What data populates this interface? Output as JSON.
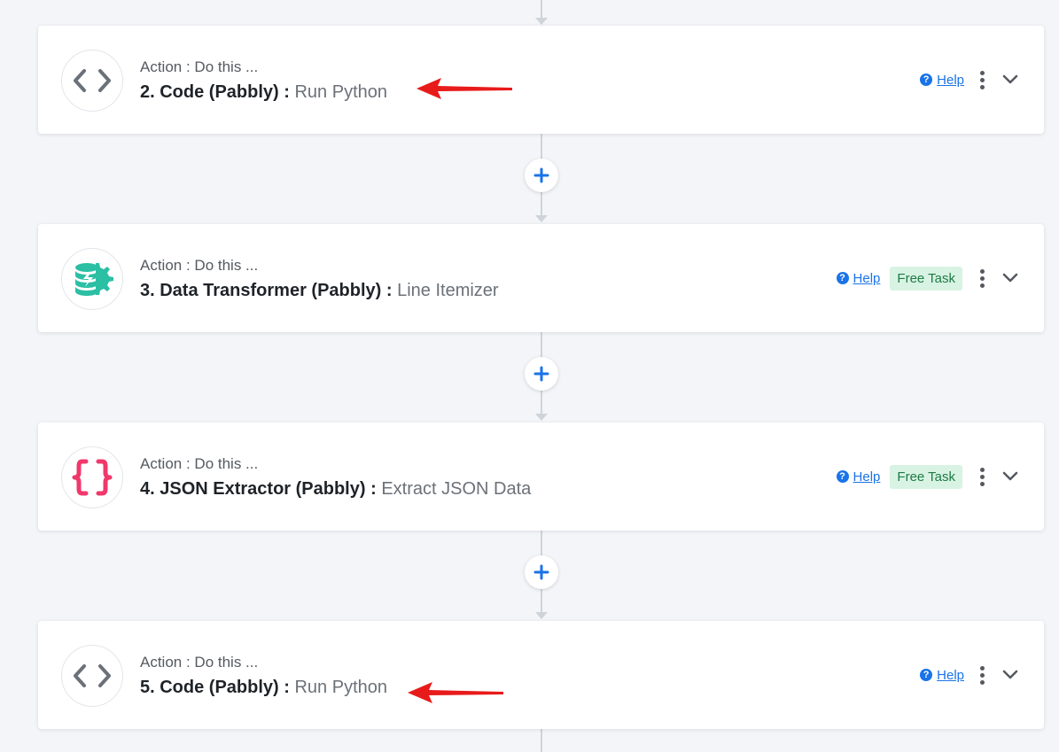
{
  "cards": [
    {
      "subtitle": "Action : Do this ...",
      "step": "2. Code (Pabbly)",
      "separator": " : ",
      "action": "Run Python",
      "icon": "code-brackets-icon",
      "help": "Help",
      "badge": ""
    },
    {
      "subtitle": "Action : Do this ...",
      "step": "3. Data Transformer (Pabbly)",
      "separator": " : ",
      "action": "Line Itemizer",
      "icon": "data-transformer-icon",
      "help": "Help",
      "badge": "Free Task"
    },
    {
      "subtitle": "Action : Do this ...",
      "step": "4. JSON Extractor (Pabbly)",
      "separator": " : ",
      "action": "Extract JSON Data",
      "icon": "json-braces-icon",
      "help": "Help",
      "badge": "Free Task"
    },
    {
      "subtitle": "Action : Do this ...",
      "step": "5. Code (Pabbly)",
      "separator": " : ",
      "action": "Run Python",
      "icon": "code-brackets-icon",
      "help": "Help",
      "badge": ""
    }
  ],
  "colors": {
    "accent": "#1a73e8",
    "annotation_arrow": "#e81b1b",
    "json_icon": "#f0386b",
    "transformer_icon": "#2bbfa4",
    "badge_bg": "#d8f3e3",
    "badge_text": "#1e7a45"
  }
}
